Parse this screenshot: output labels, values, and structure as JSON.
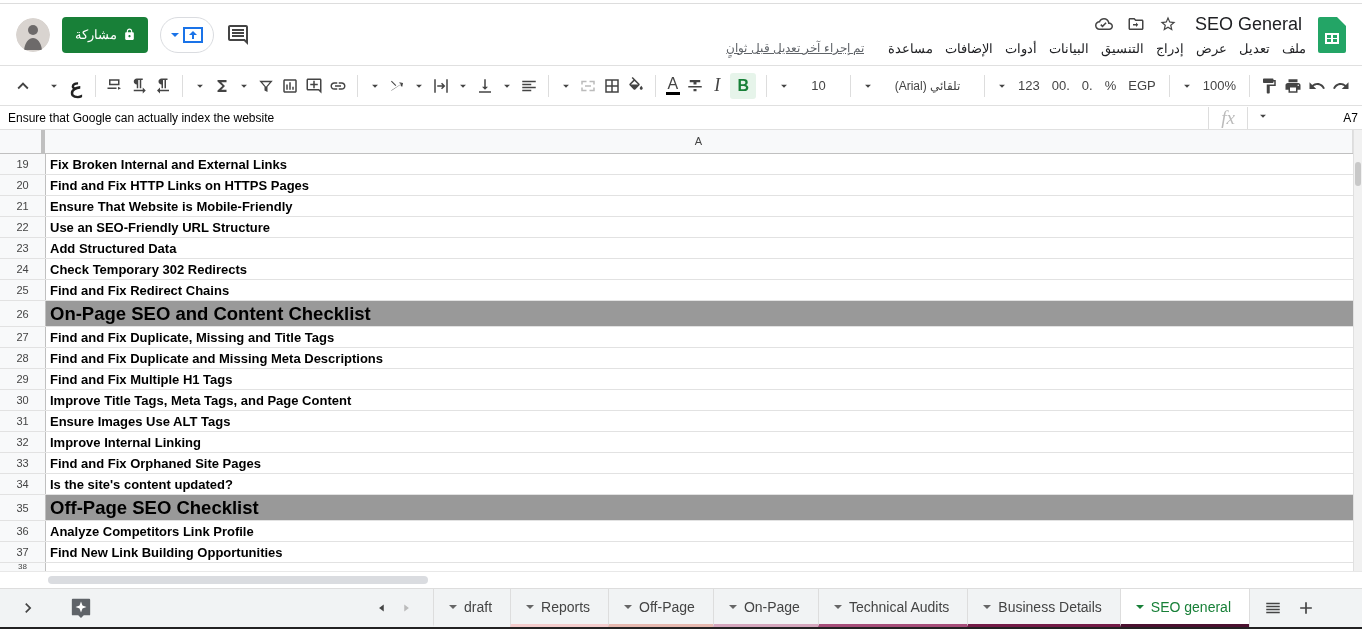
{
  "header": {
    "title": "SEO General",
    "menu": [
      "ملف",
      "تعديل",
      "عرض",
      "إدراج",
      "التنسيق",
      "البيانات",
      "أدوات",
      "الإضافات",
      "مساعدة"
    ],
    "last_edit": "تم إجراء آخر تعديل قبل ثوانٍ",
    "share_button": "مشاركة"
  },
  "toolbar": {
    "zoom": "100%",
    "currency": "EGP",
    "percent": "%",
    "decrease_decimals": ".0",
    "increase_decimals": ".00",
    "more_formats": "123",
    "font": "تلقائي (Arial)",
    "font_size": "10",
    "bold_label": "B",
    "bold": true,
    "italic_label": "I",
    "text_color_label": "A",
    "input_tools": "ع"
  },
  "formula_bar": {
    "name_box": "A7",
    "fx_label": "fx",
    "content": "Ensure that Google can actually index the website"
  },
  "columns": [
    "A"
  ],
  "rows": [
    {
      "number": "19",
      "kind": "item",
      "text": "Fix Broken Internal and External Links"
    },
    {
      "number": "20",
      "kind": "item",
      "text": "Find and Fix HTTP Links on HTTPS Pages"
    },
    {
      "number": "21",
      "kind": "item",
      "text": "Ensure That Website is Mobile-Friendly"
    },
    {
      "number": "22",
      "kind": "item",
      "text": "Use an SEO-Friendly URL Structure"
    },
    {
      "number": "23",
      "kind": "item",
      "text": "Add Structured Data"
    },
    {
      "number": "24",
      "kind": "item",
      "text": "Check Temporary 302 Redirects"
    },
    {
      "number": "25",
      "kind": "item",
      "text": "Find and Fix Redirect Chains"
    },
    {
      "number": "26",
      "kind": "section",
      "text": "On-Page SEO and Content Checklist"
    },
    {
      "number": "27",
      "kind": "item",
      "text": "Find and Fix Duplicate, Missing and Title Tags"
    },
    {
      "number": "28",
      "kind": "item",
      "text": "Find and Fix Duplicate and Missing Meta Descriptions"
    },
    {
      "number": "29",
      "kind": "item",
      "text": "Find and Fix Multiple H1 Tags"
    },
    {
      "number": "30",
      "kind": "item",
      "text": "Improve Title Tags, Meta Tags, and Page Content"
    },
    {
      "number": "31",
      "kind": "item",
      "text": "Ensure Images Use ALT Tags"
    },
    {
      "number": "32",
      "kind": "item",
      "text": "Improve Internal Linking"
    },
    {
      "number": "33",
      "kind": "item",
      "text": "Find and Fix Orphaned Site Pages"
    },
    {
      "number": "34",
      "kind": "item",
      "text": "Is the site's content updated?"
    },
    {
      "number": "35",
      "kind": "section",
      "text": "Off-Page SEO Checklist"
    },
    {
      "number": "36",
      "kind": "item",
      "text": "Analyze Competitors Link Profile"
    },
    {
      "number": "37",
      "kind": "item",
      "text": "Find New Link Building Opportunities"
    },
    {
      "number": "38",
      "kind": "item"
    }
  ],
  "sheet_tabs": [
    {
      "label": "draft",
      "selected": false
    },
    {
      "label": "Reports",
      "selected": false,
      "color": "#f4cccc"
    },
    {
      "label": "Off-Page",
      "selected": false,
      "color": "#e6b8af"
    },
    {
      "label": "On-Page",
      "selected": false,
      "color": "#d5a6bd"
    },
    {
      "label": "Technical Audits",
      "selected": false,
      "color": "#a64d79"
    },
    {
      "label": "Business Details",
      "selected": false,
      "color": "#741b47"
    },
    {
      "label": "SEO general",
      "selected": true,
      "color": "#4c1130"
    }
  ]
}
